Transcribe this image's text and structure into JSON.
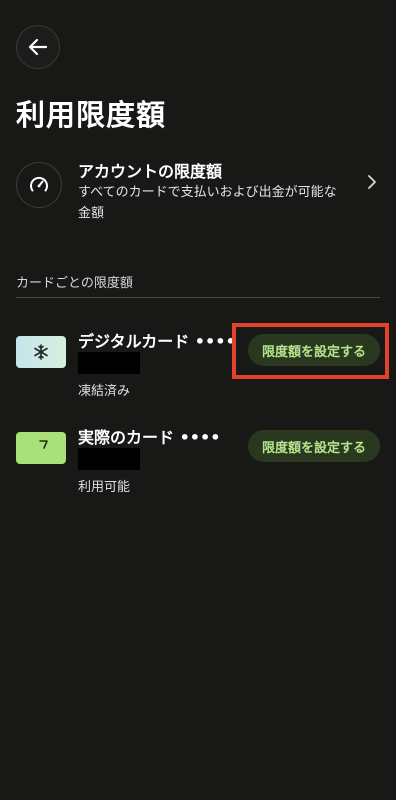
{
  "header": {
    "back_icon": "arrow-left-icon",
    "title": "利用限度額"
  },
  "account_limit": {
    "icon": "gauge-icon",
    "title": "アカウントの限度額",
    "description": "すべてのカードで支払いおよび出金が可能な金額",
    "chevron_icon": "chevron-right-icon"
  },
  "section": {
    "label": "カードごとの限度額"
  },
  "cards": [
    {
      "name": "デジタルカード ••••",
      "status": "凍結済み",
      "button_label": "限度額を設定する",
      "thumb_icon": "snowflake-icon",
      "thumb_color": "#c3e6ea"
    },
    {
      "name": "実際のカード ••••",
      "status": "利用可能",
      "button_label": "限度額を設定する",
      "thumb_icon": "card-logo-icon",
      "thumb_color": "#a8e07a"
    }
  ],
  "colors": {
    "background": "#181917",
    "button_bg": "#29381f",
    "button_text": "#b6e68d",
    "highlight": "#e2422a"
  }
}
